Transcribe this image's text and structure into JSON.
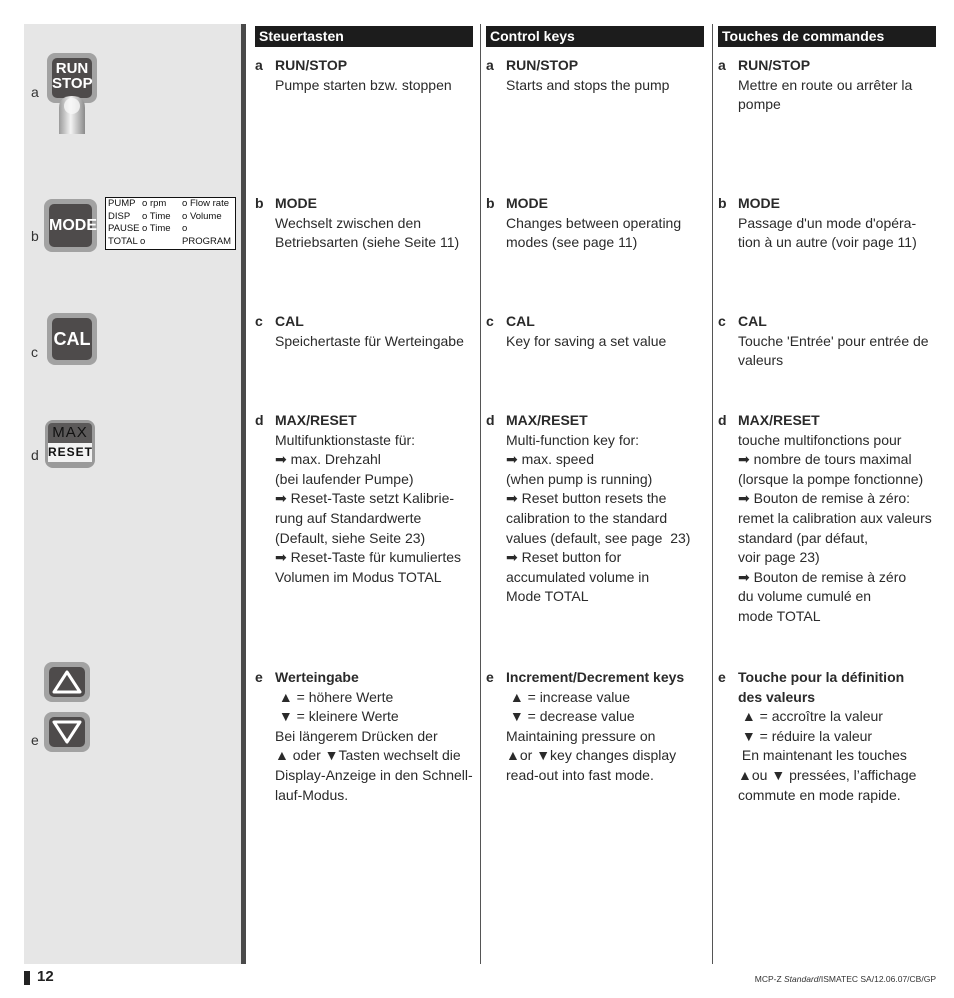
{
  "keys": {
    "a": {
      "letter": "a",
      "label_top": "RUN",
      "label_bottom": "STOP"
    },
    "b": {
      "letter": "b",
      "label": "MODE"
    },
    "c": {
      "letter": "c",
      "label": "CAL"
    },
    "d": {
      "letter": "d",
      "label_top": "MAX",
      "label_bottom": "RESET"
    },
    "e": {
      "letter": "e",
      "up_icon": "triangle-up-outline",
      "down_icon": "triangle-down-outline"
    }
  },
  "mode_display": {
    "rows": [
      {
        "mode": "PUMP",
        "opt1": "rpm",
        "opt2": "Flow rate"
      },
      {
        "mode": "DISP",
        "opt1": "Time",
        "opt2": "Volume"
      },
      {
        "mode": "PAUSE",
        "opt1": "Time",
        "opt2": "PROGRAM"
      },
      {
        "mode": "TOTAL",
        "opt1": "",
        "opt2": ""
      }
    ],
    "indicator": "o"
  },
  "columns": [
    {
      "header": "Steuertasten",
      "entries": [
        {
          "letter": "a",
          "title": [
            "RUN/STOP"
          ],
          "lines": [
            "Pumpe starten bzw. stoppen"
          ]
        },
        {
          "letter": "b",
          "title": [
            "MODE"
          ],
          "lines": [
            "Wechselt zwischen den",
            "Betriebsarten (siehe Seite 11)"
          ]
        },
        {
          "letter": "c",
          "title": [
            "CAL"
          ],
          "lines": [
            "Speichertaste für Werteingabe"
          ]
        },
        {
          "letter": "d",
          "title": [
            "MAX/RESET"
          ],
          "lines": [
            "Multifunktionstaste für:",
            "➡ max. Drehzahl",
            "(bei laufender Pumpe)",
            "➡ Reset-Taste setzt Kalibrie-",
            "rung auf Standardwerte",
            "(Default, siehe Seite 23)",
            "➡ Reset-Taste für kumuliertes",
            "Volumen im Modus TOTAL"
          ]
        },
        {
          "letter": "e",
          "title": [
            "Werteingabe"
          ],
          "lines": [
            " ▲ = höhere Werte",
            " ▼ = kleinere Werte",
            "Bei längerem Drücken der",
            "▲ oder ▼Tasten wechselt die",
            "Display-Anzeige in den Schnell-",
            "lauf-Modus."
          ]
        }
      ]
    },
    {
      "header": "Control keys",
      "entries": [
        {
          "letter": "a",
          "title": [
            "RUN/STOP"
          ],
          "lines": [
            "Starts and stops the pump"
          ]
        },
        {
          "letter": "b",
          "title": [
            "MODE"
          ],
          "lines": [
            "Changes between operating",
            "modes (see page 11)"
          ]
        },
        {
          "letter": "c",
          "title": [
            "CAL"
          ],
          "lines": [
            "Key for saving a set value"
          ]
        },
        {
          "letter": "d",
          "title": [
            "MAX/RESET"
          ],
          "lines": [
            "Multi-function key for:",
            "➡ max. speed",
            "(when pump is running)",
            "➡ Reset button resets the",
            "calibration to the standard",
            "values (default, see page  23)",
            "➡ Reset button for",
            "accumulated volume in",
            "Mode TOTAL"
          ]
        },
        {
          "letter": "e",
          "title": [
            "Increment/Decrement keys"
          ],
          "lines": [
            " ▲ = increase value",
            " ▼ = decrease value",
            "Maintaining pressure on",
            "▲or ▼key changes display",
            "read-out into fast mode."
          ]
        }
      ]
    },
    {
      "header": "Touches de commandes",
      "entries": [
        {
          "letter": "a",
          "title": [
            "RUN/STOP"
          ],
          "lines": [
            "Mettre en route ou arrêter la",
            "pompe"
          ]
        },
        {
          "letter": "b",
          "title": [
            "MODE"
          ],
          "lines": [
            "Passage d'un mode d'opéra-",
            "tion à un autre (voir page 11)"
          ]
        },
        {
          "letter": "c",
          "title": [
            "CAL"
          ],
          "lines": [
            "Touche 'Entrée' pour entrée de",
            "valeurs"
          ]
        },
        {
          "letter": "d",
          "title": [
            "MAX/RESET"
          ],
          "lines": [
            "touche multifonctions pour",
            "➡ nombre de tours maximal",
            "(lorsque la pompe fonctionne)",
            "➡ Bouton de remise à zéro:",
            "remet la calibration aux valeurs",
            "standard (par défaut,",
            "voir page 23)",
            "➡ Bouton de remise à zéro",
            "du volume cumulé en",
            "mode TOTAL"
          ]
        },
        {
          "letter": "e",
          "title": [
            "Touche pour la définition",
            "des valeurs"
          ],
          "lines": [
            " ▲ = accroître la valeur",
            " ▼ = réduire la valeur",
            " En maintenant les touches",
            "▲ou ▼ pressées, l’affichage",
            "commute en mode rapide."
          ]
        }
      ]
    }
  ],
  "footer": {
    "page_number": "12",
    "ref_prefix": "MCP-Z ",
    "ref_italic": "Standard",
    "ref_suffix": "/ISMATEC SA/12.06.07/CB/GP"
  }
}
